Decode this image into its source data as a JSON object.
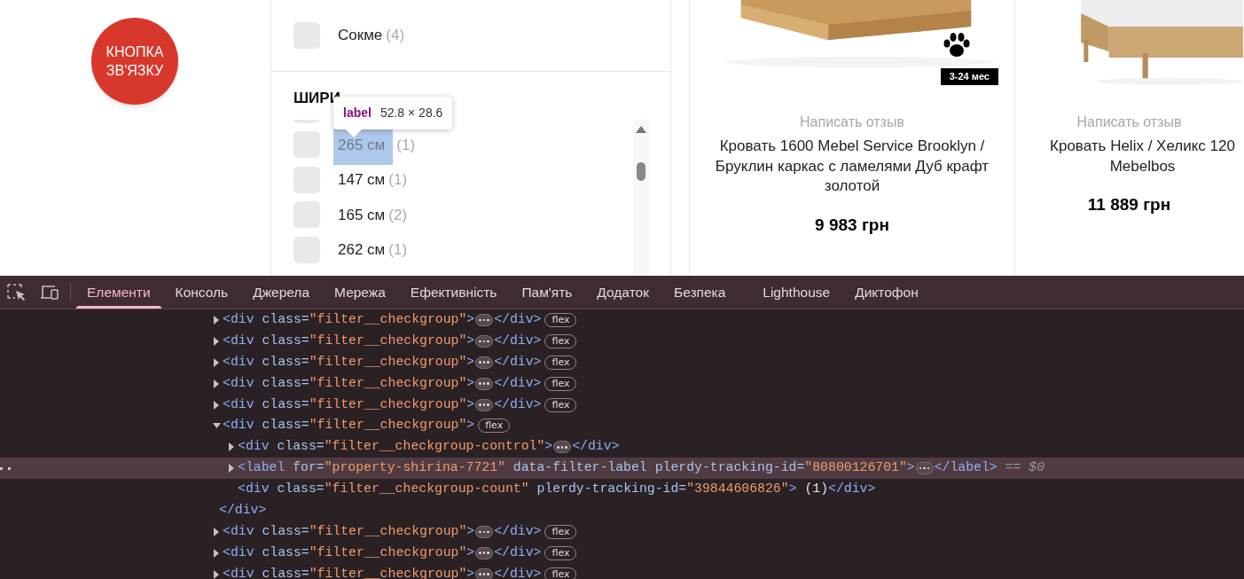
{
  "contact_button": {
    "label": "КНОПКА ЗВ'ЯЗКУ"
  },
  "filter": {
    "brand_items": [
      {
        "label": "Сокме",
        "count": "(4)",
        "checked": false,
        "highlighted": false
      }
    ],
    "section_title": "ШИРИ",
    "width_items": [
      {
        "checked": false
      },
      {
        "label": "265 см",
        "count": "(1)",
        "checked": false,
        "highlighted": true
      },
      {
        "label": "147 см",
        "count": "(1)",
        "checked": false,
        "highlighted": false
      },
      {
        "label": "165 см",
        "count": "(2)",
        "checked": false,
        "highlighted": false
      },
      {
        "label": "262 см",
        "count": "(1)",
        "checked": false,
        "highlighted": false
      }
    ]
  },
  "inspect_tooltip": {
    "tag": "label",
    "size": "52.8 × 28.6"
  },
  "products": [
    {
      "review_link": "Написать отзыв",
      "title": "Кровать 1600 Mebel Service Brooklyn / Бруклин каркас с ламелями Дуб крафт золотой",
      "price": "9 983 грн",
      "paw_icon": true,
      "badge": "3-24 мес"
    },
    {
      "review_link": "Написать отзыв",
      "title": "Кровать Helix / Хеликс 120 Mebelbos",
      "price": "11 889 грн",
      "paw_icon": false
    }
  ],
  "devtools": {
    "tabs": [
      {
        "label": "Елементи",
        "selected": true
      },
      {
        "label": "Консоль",
        "selected": false
      },
      {
        "label": "Джерела",
        "selected": false
      },
      {
        "label": "Мережа",
        "selected": false
      },
      {
        "label": "Ефективність",
        "selected": false
      },
      {
        "label": "Пам'ять",
        "selected": false
      },
      {
        "label": "Додаток",
        "selected": false
      },
      {
        "label": "Безпека",
        "selected": false
      },
      {
        "label": "Lighthouse",
        "selected": false
      },
      {
        "label": "Диктофон",
        "selected": false
      }
    ],
    "nodes": [
      {
        "tokens": [
          {
            "kind": "tag",
            "text": "<div"
          },
          {
            "kind": "attr",
            "text": "class"
          },
          {
            "kind": "eq",
            "text": "="
          },
          {
            "kind": "value",
            "text": "\"filter__checkgroup\""
          },
          {
            "kind": "tag",
            "text": ">"
          },
          {
            "kind": "ellipsis"
          },
          {
            "kind": "tag",
            "text": "</div>"
          }
        ],
        "badge": "flex",
        "expanded": false,
        "selected": false
      },
      {
        "tokens": [
          {
            "kind": "tag",
            "text": "<div"
          },
          {
            "kind": "attr",
            "text": "class"
          },
          {
            "kind": "eq",
            "text": "="
          },
          {
            "kind": "value",
            "text": "\"filter__checkgroup\""
          },
          {
            "kind": "tag",
            "text": ">"
          },
          {
            "kind": "ellipsis"
          },
          {
            "kind": "tag",
            "text": "</div>"
          }
        ],
        "badge": "flex",
        "expanded": false,
        "selected": false
      },
      {
        "tokens": [
          {
            "kind": "tag",
            "text": "<div"
          },
          {
            "kind": "attr",
            "text": "class"
          },
          {
            "kind": "eq",
            "text": "="
          },
          {
            "kind": "value",
            "text": "\"filter__checkgroup\""
          },
          {
            "kind": "tag",
            "text": ">"
          },
          {
            "kind": "ellipsis"
          },
          {
            "kind": "tag",
            "text": "</div>"
          }
        ],
        "badge": "flex",
        "expanded": false,
        "selected": false
      },
      {
        "tokens": [
          {
            "kind": "tag",
            "text": "<div"
          },
          {
            "kind": "attr",
            "text": "class"
          },
          {
            "kind": "eq",
            "text": "="
          },
          {
            "kind": "value",
            "text": "\"filter__checkgroup\""
          },
          {
            "kind": "tag",
            "text": ">"
          },
          {
            "kind": "ellipsis"
          },
          {
            "kind": "tag",
            "text": "</div>"
          }
        ],
        "badge": "flex",
        "expanded": false,
        "selected": false
      },
      {
        "tokens": [
          {
            "kind": "tag",
            "text": "<div"
          },
          {
            "kind": "attr",
            "text": "class"
          },
          {
            "kind": "eq",
            "text": "="
          },
          {
            "kind": "value",
            "text": "\"filter__checkgroup\""
          },
          {
            "kind": "tag",
            "text": ">"
          },
          {
            "kind": "ellipsis"
          },
          {
            "kind": "tag",
            "text": "</div>"
          }
        ],
        "badge": "flex",
        "expanded": false,
        "selected": false
      },
      {
        "tokens": [
          {
            "kind": "tag",
            "text": "<div"
          },
          {
            "kind": "attr",
            "text": "class"
          },
          {
            "kind": "eq",
            "text": "="
          },
          {
            "kind": "value",
            "text": "\"filter__checkgroup\""
          },
          {
            "kind": "tag",
            "text": ">"
          }
        ],
        "badge": "flex",
        "expanded": true,
        "selected": false,
        "closing": "</div>",
        "children": [
          {
            "tokens": [
              {
                "kind": "tag",
                "text": "<div"
              },
              {
                "kind": "attr",
                "text": "class"
              },
              {
                "kind": "eq",
                "text": "="
              },
              {
                "kind": "value",
                "text": "\"filter__checkgroup-control\""
              },
              {
                "kind": "tag",
                "text": ">"
              },
              {
                "kind": "ellipsis"
              },
              {
                "kind": "tag",
                "text": "</div>"
              }
            ],
            "expanded": false,
            "selected": false
          },
          {
            "tokens": [
              {
                "kind": "tag",
                "text": "<label"
              },
              {
                "kind": "attr",
                "text": "for"
              },
              {
                "kind": "eq",
                "text": "="
              },
              {
                "kind": "value",
                "text": "\"property-shirina-7721\""
              },
              {
                "kind": "attr",
                "text": "data-filter-label"
              },
              {
                "kind": "attr",
                "text": "plerdy-tracking-id"
              },
              {
                "kind": "eq",
                "text": "="
              },
              {
                "kind": "value",
                "text": "\"80800126701\""
              },
              {
                "kind": "tag",
                "text": ">"
              },
              {
                "kind": "ellipsis"
              },
              {
                "kind": "tag",
                "text": "</label>"
              },
              {
                "kind": "ref",
                "text": "== $0"
              }
            ],
            "expanded": false,
            "selected": true
          },
          {
            "tokens": [
              {
                "kind": "tag",
                "text": "<div"
              },
              {
                "kind": "attr",
                "text": "class"
              },
              {
                "kind": "eq",
                "text": "="
              },
              {
                "kind": "value",
                "text": "\"filter__checkgroup-count\""
              },
              {
                "kind": "attr",
                "text": "plerdy-tracking-id"
              },
              {
                "kind": "eq",
                "text": "="
              },
              {
                "kind": "value",
                "text": "\"39844606826\""
              },
              {
                "kind": "tag",
                "text": ">"
              },
              {
                "kind": "text",
                "text": "(1)"
              },
              {
                "kind": "tag",
                "text": "</div>"
              }
            ],
            "selected": false
          }
        ]
      },
      {
        "tokens": [
          {
            "kind": "tag",
            "text": "<div"
          },
          {
            "kind": "attr",
            "text": "class"
          },
          {
            "kind": "eq",
            "text": "="
          },
          {
            "kind": "value",
            "text": "\"filter__checkgroup\""
          },
          {
            "kind": "tag",
            "text": ">"
          },
          {
            "kind": "ellipsis"
          },
          {
            "kind": "tag",
            "text": "</div>"
          }
        ],
        "badge": "flex",
        "expanded": false,
        "selected": false
      },
      {
        "tokens": [
          {
            "kind": "tag",
            "text": "<div"
          },
          {
            "kind": "attr",
            "text": "class"
          },
          {
            "kind": "eq",
            "text": "="
          },
          {
            "kind": "value",
            "text": "\"filter__checkgroup\""
          },
          {
            "kind": "tag",
            "text": ">"
          },
          {
            "kind": "ellipsis"
          },
          {
            "kind": "tag",
            "text": "</div>"
          }
        ],
        "badge": "flex",
        "expanded": false,
        "selected": false
      },
      {
        "tokens": [
          {
            "kind": "tag",
            "text": "<div"
          },
          {
            "kind": "attr",
            "text": "class"
          },
          {
            "kind": "eq",
            "text": "="
          },
          {
            "kind": "value",
            "text": "\"filter__checkgroup\""
          },
          {
            "kind": "tag",
            "text": ">"
          },
          {
            "kind": "ellipsis"
          },
          {
            "kind": "tag",
            "text": "</div>"
          }
        ],
        "badge": "flex",
        "expanded": false,
        "selected": false
      }
    ]
  }
}
